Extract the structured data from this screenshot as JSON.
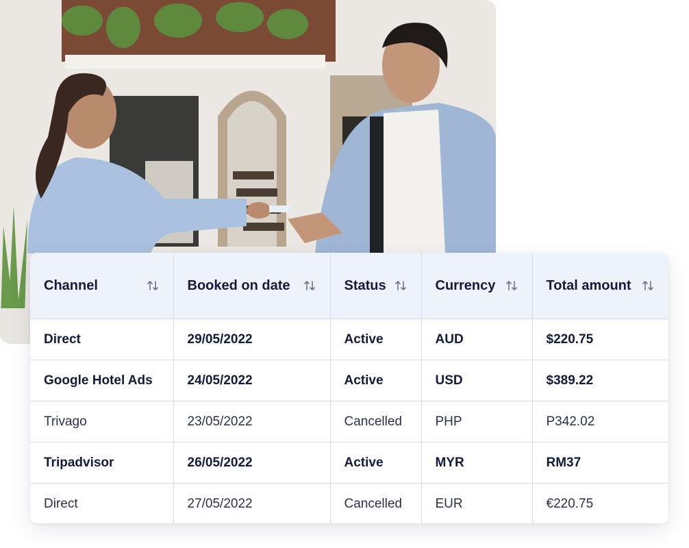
{
  "photo": {
    "description_icon": "reception-photo"
  },
  "table": {
    "columns": [
      {
        "label": "Channel",
        "sort_icon": "sort-icon"
      },
      {
        "label": "Booked on date",
        "sort_icon": "sort-icon"
      },
      {
        "label": "Status",
        "sort_icon": "sort-icon"
      },
      {
        "label": "Currency",
        "sort_icon": "sort-icon"
      },
      {
        "label": "Total amount",
        "sort_icon": "sort-icon"
      }
    ],
    "rows": [
      {
        "channel": "Direct",
        "date": "29/05/2022",
        "status": "Active",
        "currency": "AUD",
        "amount": "$220.75",
        "emphasis": "bold"
      },
      {
        "channel": "Google Hotel Ads",
        "date": "24/05/2022",
        "status": "Active",
        "currency": "USD",
        "amount": "$389.22",
        "emphasis": "bold"
      },
      {
        "channel": "Trivago",
        "date": "23/05/2022",
        "status": "Cancelled",
        "currency": "PHP",
        "amount": "P342.02",
        "emphasis": "normal"
      },
      {
        "channel": "Tripadvisor",
        "date": "26/05/2022",
        "status": "Active",
        "currency": "MYR",
        "amount": "RM37",
        "emphasis": "bold"
      },
      {
        "channel": "Direct",
        "date": "27/05/2022",
        "status": "Cancelled",
        "currency": "EUR",
        "amount": "€220.75",
        "emphasis": "normal"
      }
    ]
  },
  "colors": {
    "header_bg": "#eef2fb",
    "text_dark": "#141a3a",
    "border": "#d6dbe6"
  }
}
